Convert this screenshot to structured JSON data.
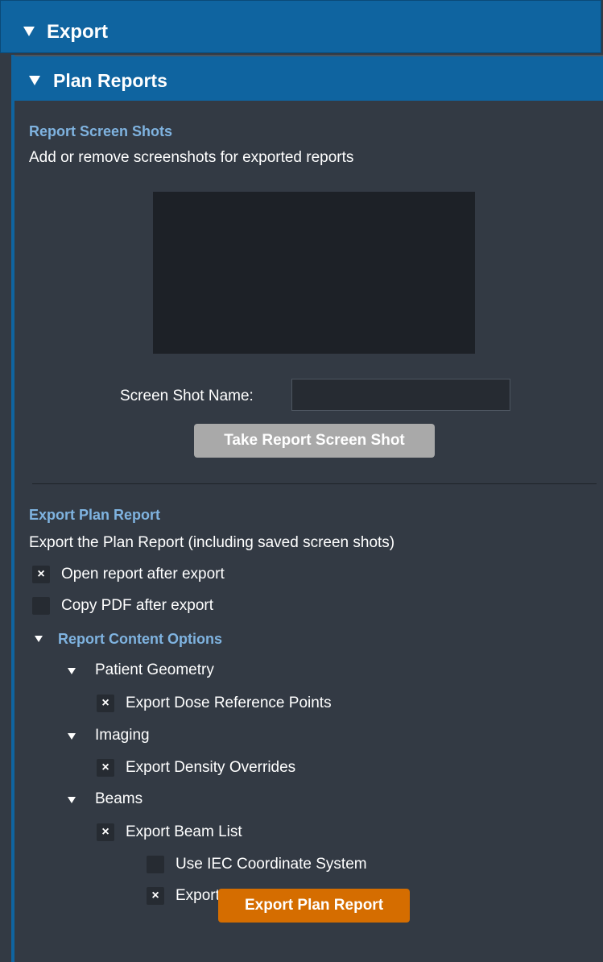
{
  "export_panel": {
    "title": "Export"
  },
  "plan_reports": {
    "title": "Plan Reports",
    "screenshots": {
      "heading": "Report Screen Shots",
      "description": "Add or remove screenshots for exported reports",
      "name_label": "Screen Shot Name:",
      "name_value": "",
      "take_button": "Take Report Screen Shot"
    },
    "export_report": {
      "heading": "Export Plan Report",
      "description": "Export the Plan Report (including saved screen shots)",
      "options": [
        {
          "label": "Open report after export",
          "checked": true
        },
        {
          "label": "Copy PDF after export",
          "checked": false
        }
      ],
      "content_options": {
        "heading": "Report Content Options",
        "groups": [
          {
            "label": "Patient Geometry",
            "items": [
              {
                "label": "Export Dose Reference Points",
                "checked": true
              }
            ]
          },
          {
            "label": "Imaging",
            "items": [
              {
                "label": "Export Density Overrides",
                "checked": true
              }
            ]
          },
          {
            "label": "Beams",
            "items": [
              {
                "label": "Export Beam List",
                "checked": true,
                "sub_items": [
                  {
                    "label": "Use IEC Coordinate System",
                    "checked": false
                  },
                  {
                    "label": "Export Ordered Hardware IDs",
                    "checked": true
                  }
                ]
              }
            ]
          }
        ]
      },
      "export_button": "Export Plan Report"
    }
  },
  "colors": {
    "header_blue": "#0f64a0",
    "panel_bg": "#333a44",
    "section_heading": "#7fb3e0",
    "export_button": "#d56d00",
    "take_button": "#a9a9a9"
  },
  "icons": {
    "checked_mark": "×"
  }
}
